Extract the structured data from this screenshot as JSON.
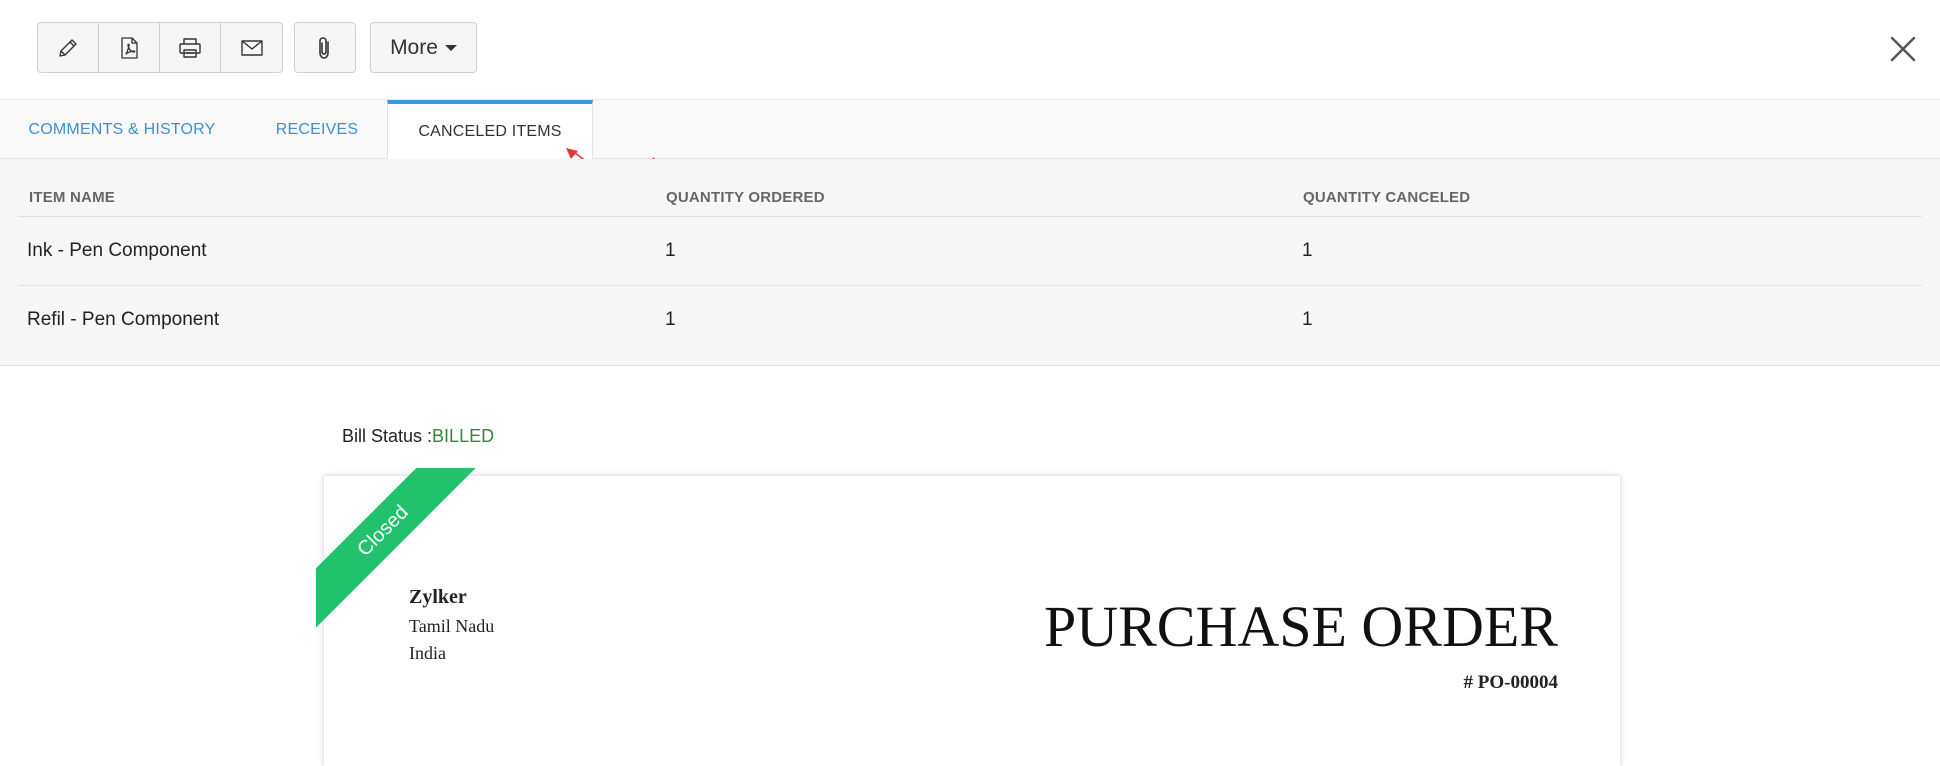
{
  "toolbar": {
    "buttons": [
      {
        "icon": "pencil-icon",
        "name": "edit-button"
      },
      {
        "icon": "pdf-icon",
        "name": "pdf-button"
      },
      {
        "icon": "printer-icon",
        "name": "print-button"
      },
      {
        "icon": "mail-icon",
        "name": "email-button"
      }
    ],
    "attach_icon": "paperclip-icon",
    "more_label": "More",
    "close_icon": "close-icon"
  },
  "tabs": [
    {
      "label": "COMMENTS & HISTORY",
      "active": false
    },
    {
      "label": "RECEIVES",
      "active": false
    },
    {
      "label": "CANCELED ITEMS",
      "active": true
    }
  ],
  "canceled_items": {
    "columns": [
      "ITEM NAME",
      "QUANTITY ORDERED",
      "QUANTITY CANCELED"
    ],
    "rows": [
      {
        "item_name": "Ink - Pen Component",
        "quantity_ordered": "1",
        "quantity_canceled": "1"
      },
      {
        "item_name": "Refil - Pen Component",
        "quantity_ordered": "1",
        "quantity_canceled": "1"
      }
    ]
  },
  "bill_status": {
    "label": "Bill Status :",
    "value": "BILLED"
  },
  "document": {
    "ribbon": "Closed",
    "organization": {
      "name": "Zylker",
      "address_lines": [
        "Tamil Nadu",
        "India"
      ]
    },
    "title": "PURCHASE ORDER",
    "number": "# PO-00004"
  },
  "colors": {
    "tab_link": "#408dd3",
    "tab_active_border": "#3a9ad9",
    "status_billed": "#2e8b3a",
    "ribbon_green": "#22c16b",
    "annotation_arrow": "#e53935"
  }
}
